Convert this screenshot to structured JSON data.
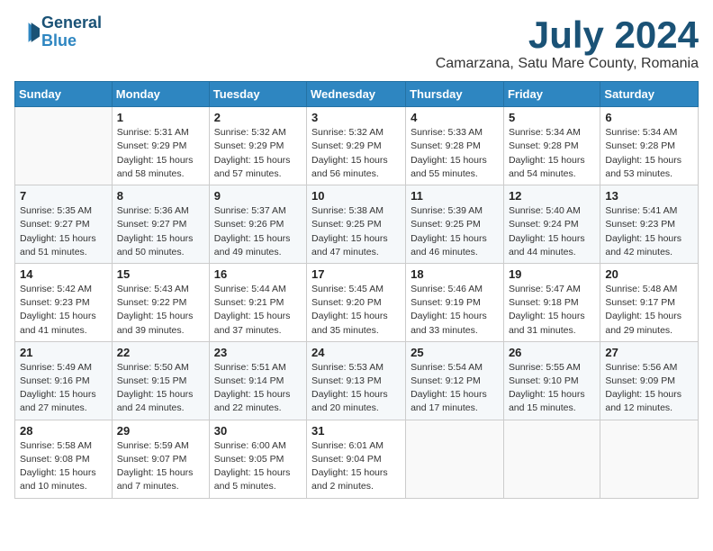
{
  "logo": {
    "line1": "General",
    "line2": "Blue"
  },
  "title": "July 2024",
  "subtitle": "Camarzana, Satu Mare County, Romania",
  "weekdays": [
    "Sunday",
    "Monday",
    "Tuesday",
    "Wednesday",
    "Thursday",
    "Friday",
    "Saturday"
  ],
  "weeks": [
    [
      {
        "day": "",
        "info": ""
      },
      {
        "day": "1",
        "info": "Sunrise: 5:31 AM\nSunset: 9:29 PM\nDaylight: 15 hours\nand 58 minutes."
      },
      {
        "day": "2",
        "info": "Sunrise: 5:32 AM\nSunset: 9:29 PM\nDaylight: 15 hours\nand 57 minutes."
      },
      {
        "day": "3",
        "info": "Sunrise: 5:32 AM\nSunset: 9:29 PM\nDaylight: 15 hours\nand 56 minutes."
      },
      {
        "day": "4",
        "info": "Sunrise: 5:33 AM\nSunset: 9:28 PM\nDaylight: 15 hours\nand 55 minutes."
      },
      {
        "day": "5",
        "info": "Sunrise: 5:34 AM\nSunset: 9:28 PM\nDaylight: 15 hours\nand 54 minutes."
      },
      {
        "day": "6",
        "info": "Sunrise: 5:34 AM\nSunset: 9:28 PM\nDaylight: 15 hours\nand 53 minutes."
      }
    ],
    [
      {
        "day": "7",
        "info": "Sunrise: 5:35 AM\nSunset: 9:27 PM\nDaylight: 15 hours\nand 51 minutes."
      },
      {
        "day": "8",
        "info": "Sunrise: 5:36 AM\nSunset: 9:27 PM\nDaylight: 15 hours\nand 50 minutes."
      },
      {
        "day": "9",
        "info": "Sunrise: 5:37 AM\nSunset: 9:26 PM\nDaylight: 15 hours\nand 49 minutes."
      },
      {
        "day": "10",
        "info": "Sunrise: 5:38 AM\nSunset: 9:25 PM\nDaylight: 15 hours\nand 47 minutes."
      },
      {
        "day": "11",
        "info": "Sunrise: 5:39 AM\nSunset: 9:25 PM\nDaylight: 15 hours\nand 46 minutes."
      },
      {
        "day": "12",
        "info": "Sunrise: 5:40 AM\nSunset: 9:24 PM\nDaylight: 15 hours\nand 44 minutes."
      },
      {
        "day": "13",
        "info": "Sunrise: 5:41 AM\nSunset: 9:23 PM\nDaylight: 15 hours\nand 42 minutes."
      }
    ],
    [
      {
        "day": "14",
        "info": "Sunrise: 5:42 AM\nSunset: 9:23 PM\nDaylight: 15 hours\nand 41 minutes."
      },
      {
        "day": "15",
        "info": "Sunrise: 5:43 AM\nSunset: 9:22 PM\nDaylight: 15 hours\nand 39 minutes."
      },
      {
        "day": "16",
        "info": "Sunrise: 5:44 AM\nSunset: 9:21 PM\nDaylight: 15 hours\nand 37 minutes."
      },
      {
        "day": "17",
        "info": "Sunrise: 5:45 AM\nSunset: 9:20 PM\nDaylight: 15 hours\nand 35 minutes."
      },
      {
        "day": "18",
        "info": "Sunrise: 5:46 AM\nSunset: 9:19 PM\nDaylight: 15 hours\nand 33 minutes."
      },
      {
        "day": "19",
        "info": "Sunrise: 5:47 AM\nSunset: 9:18 PM\nDaylight: 15 hours\nand 31 minutes."
      },
      {
        "day": "20",
        "info": "Sunrise: 5:48 AM\nSunset: 9:17 PM\nDaylight: 15 hours\nand 29 minutes."
      }
    ],
    [
      {
        "day": "21",
        "info": "Sunrise: 5:49 AM\nSunset: 9:16 PM\nDaylight: 15 hours\nand 27 minutes."
      },
      {
        "day": "22",
        "info": "Sunrise: 5:50 AM\nSunset: 9:15 PM\nDaylight: 15 hours\nand 24 minutes."
      },
      {
        "day": "23",
        "info": "Sunrise: 5:51 AM\nSunset: 9:14 PM\nDaylight: 15 hours\nand 22 minutes."
      },
      {
        "day": "24",
        "info": "Sunrise: 5:53 AM\nSunset: 9:13 PM\nDaylight: 15 hours\nand 20 minutes."
      },
      {
        "day": "25",
        "info": "Sunrise: 5:54 AM\nSunset: 9:12 PM\nDaylight: 15 hours\nand 17 minutes."
      },
      {
        "day": "26",
        "info": "Sunrise: 5:55 AM\nSunset: 9:10 PM\nDaylight: 15 hours\nand 15 minutes."
      },
      {
        "day": "27",
        "info": "Sunrise: 5:56 AM\nSunset: 9:09 PM\nDaylight: 15 hours\nand 12 minutes."
      }
    ],
    [
      {
        "day": "28",
        "info": "Sunrise: 5:58 AM\nSunset: 9:08 PM\nDaylight: 15 hours\nand 10 minutes."
      },
      {
        "day": "29",
        "info": "Sunrise: 5:59 AM\nSunset: 9:07 PM\nDaylight: 15 hours\nand 7 minutes."
      },
      {
        "day": "30",
        "info": "Sunrise: 6:00 AM\nSunset: 9:05 PM\nDaylight: 15 hours\nand 5 minutes."
      },
      {
        "day": "31",
        "info": "Sunrise: 6:01 AM\nSunset: 9:04 PM\nDaylight: 15 hours\nand 2 minutes."
      },
      {
        "day": "",
        "info": ""
      },
      {
        "day": "",
        "info": ""
      },
      {
        "day": "",
        "info": ""
      }
    ]
  ]
}
